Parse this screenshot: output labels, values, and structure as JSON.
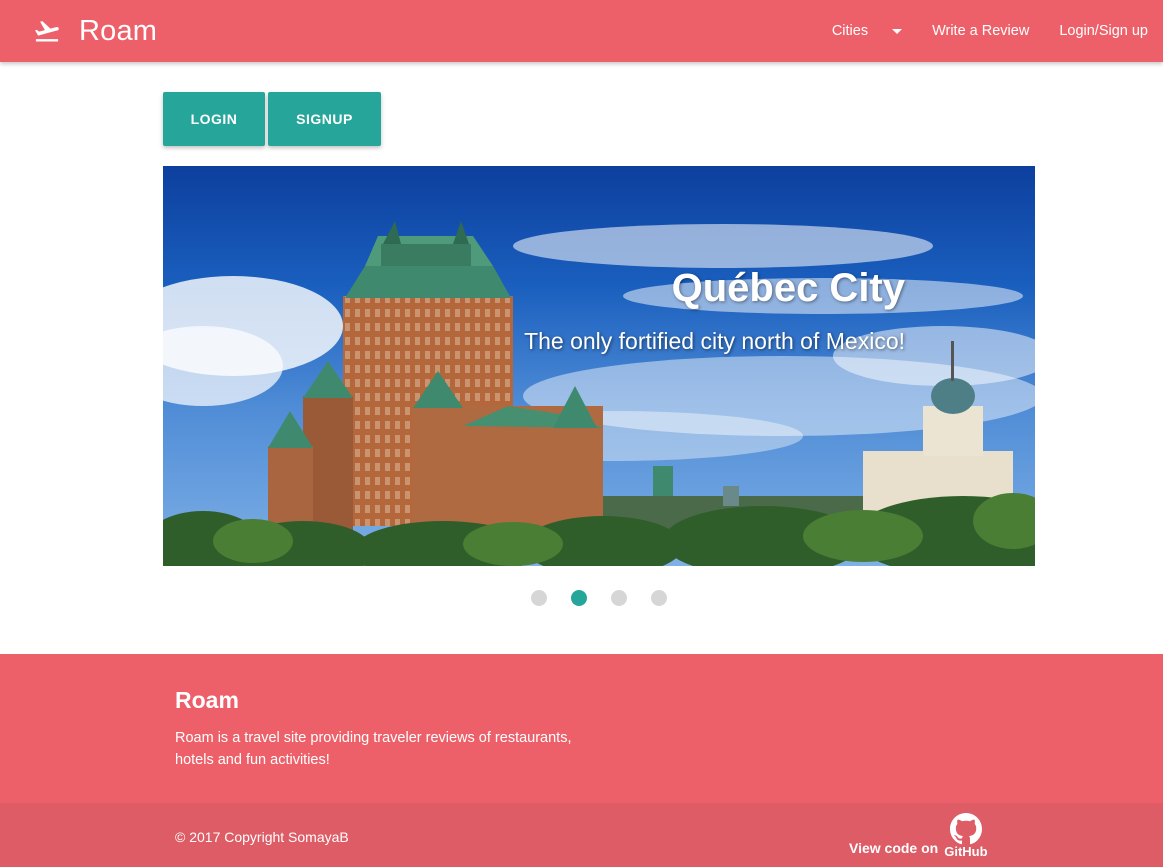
{
  "nav": {
    "brand_icon": "plane-takeoff-icon",
    "brand": "Roam",
    "cities_label": "Cities",
    "review_label": "Write a Review",
    "login_label": "Login/Sign up"
  },
  "auth": {
    "login_label": "LOGIN",
    "signup_label": "SIGNUP"
  },
  "carousel": {
    "title": "Québec City",
    "caption": "The only fortified city north of Mexico!",
    "slide_count": 4,
    "active_index": 1
  },
  "footer": {
    "title": "Roam",
    "description": "Roam is a travel site providing traveler reviews of restaurants, hotels and fun activities!",
    "copyright": "© 2017 Copyright SomayaB",
    "view_code_label": "View code on",
    "github_label": "GitHub",
    "github_icon": "github-icon"
  },
  "colors": {
    "primary": "#ee6069",
    "footer_copyright": "#dd5c65",
    "accent": "#26a69a",
    "dot_inactive": "#d6d6d6"
  }
}
